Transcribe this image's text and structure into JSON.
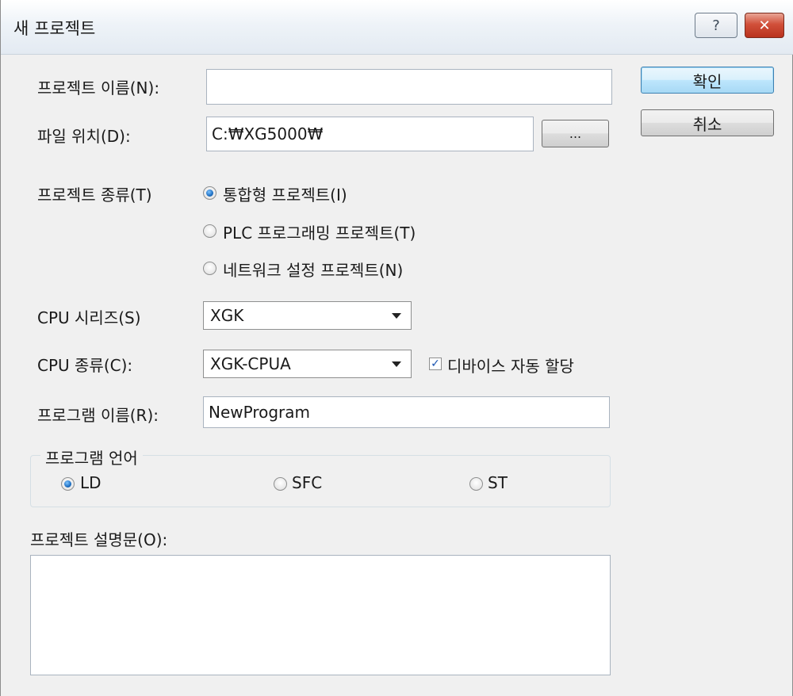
{
  "window": {
    "title": "새 프로젝트",
    "help_label": "?",
    "close_label": "✕"
  },
  "project_name": {
    "label": "프로젝트 이름(N):",
    "value": ""
  },
  "file_location": {
    "label": "파일 위치(D):",
    "value": "C:₩XG5000₩",
    "browse_label": "..."
  },
  "buttons": {
    "ok": "확인",
    "cancel": "취소"
  },
  "project_type": {
    "label": "프로젝트 종류(T)",
    "options": [
      "통합형 프로젝트(I)",
      "PLC 프로그래밍 프로젝트(T)",
      "네트워크 설정 프로젝트(N)"
    ],
    "selected": "통합형 프로젝트(I)"
  },
  "cpu_series": {
    "label": "CPU 시리즈(S)",
    "value": "XGK"
  },
  "cpu_type": {
    "label": "CPU 종류(C):",
    "value": "XGK-CPUA"
  },
  "auto_alloc": {
    "label": "디바이스 자동 할당",
    "checked": true
  },
  "program_name": {
    "label": "프로그램 이름(R):",
    "value": "NewProgram"
  },
  "program_language": {
    "legend": "프로그램 언어",
    "options": [
      "LD",
      "SFC",
      "ST"
    ],
    "selected": "LD"
  },
  "description": {
    "label": "프로젝트 설명문(O):",
    "value": ""
  },
  "colors": {
    "dialog_bg": "#f0f0f0",
    "radio_selected": "#1e6fc2",
    "close_button": "#c7402b"
  },
  "icons": [
    "help-icon",
    "close-icon",
    "dropdown-arrow-icon",
    "checkmark-icon"
  ]
}
